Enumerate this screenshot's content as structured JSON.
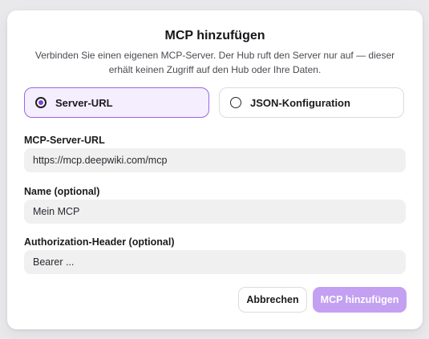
{
  "dialog": {
    "title": "MCP hinzufügen",
    "description": "Verbinden Sie einen eigenen MCP-Server. Der Hub ruft den Server nur auf — dieser erhält keinen Zugriff auf den Hub oder Ihre Daten."
  },
  "mode": {
    "selected": "server-url",
    "options": [
      {
        "id": "server-url",
        "label": "Server-URL"
      },
      {
        "id": "json-config",
        "label": "JSON-Konfiguration"
      }
    ]
  },
  "fields": {
    "server_url": {
      "label": "MCP-Server-URL",
      "placeholder": "https://mcp.deepwiki.com/mcp"
    },
    "name": {
      "label": "Name (optional)",
      "placeholder": "Mein MCP"
    },
    "auth_header": {
      "label": "Authorization-Header (optional)",
      "placeholder": "Bearer ..."
    }
  },
  "actions": {
    "cancel_label": "Abbrechen",
    "submit_label": "MCP hinzufügen"
  },
  "colors": {
    "accent": "#9b67e0",
    "accent_bg": "#f4eeff",
    "submit_disabled": "#c3a0f2"
  },
  "icons": {
    "radio_selected": "radio-selected-icon",
    "radio_unselected": "radio-unselected-icon"
  }
}
